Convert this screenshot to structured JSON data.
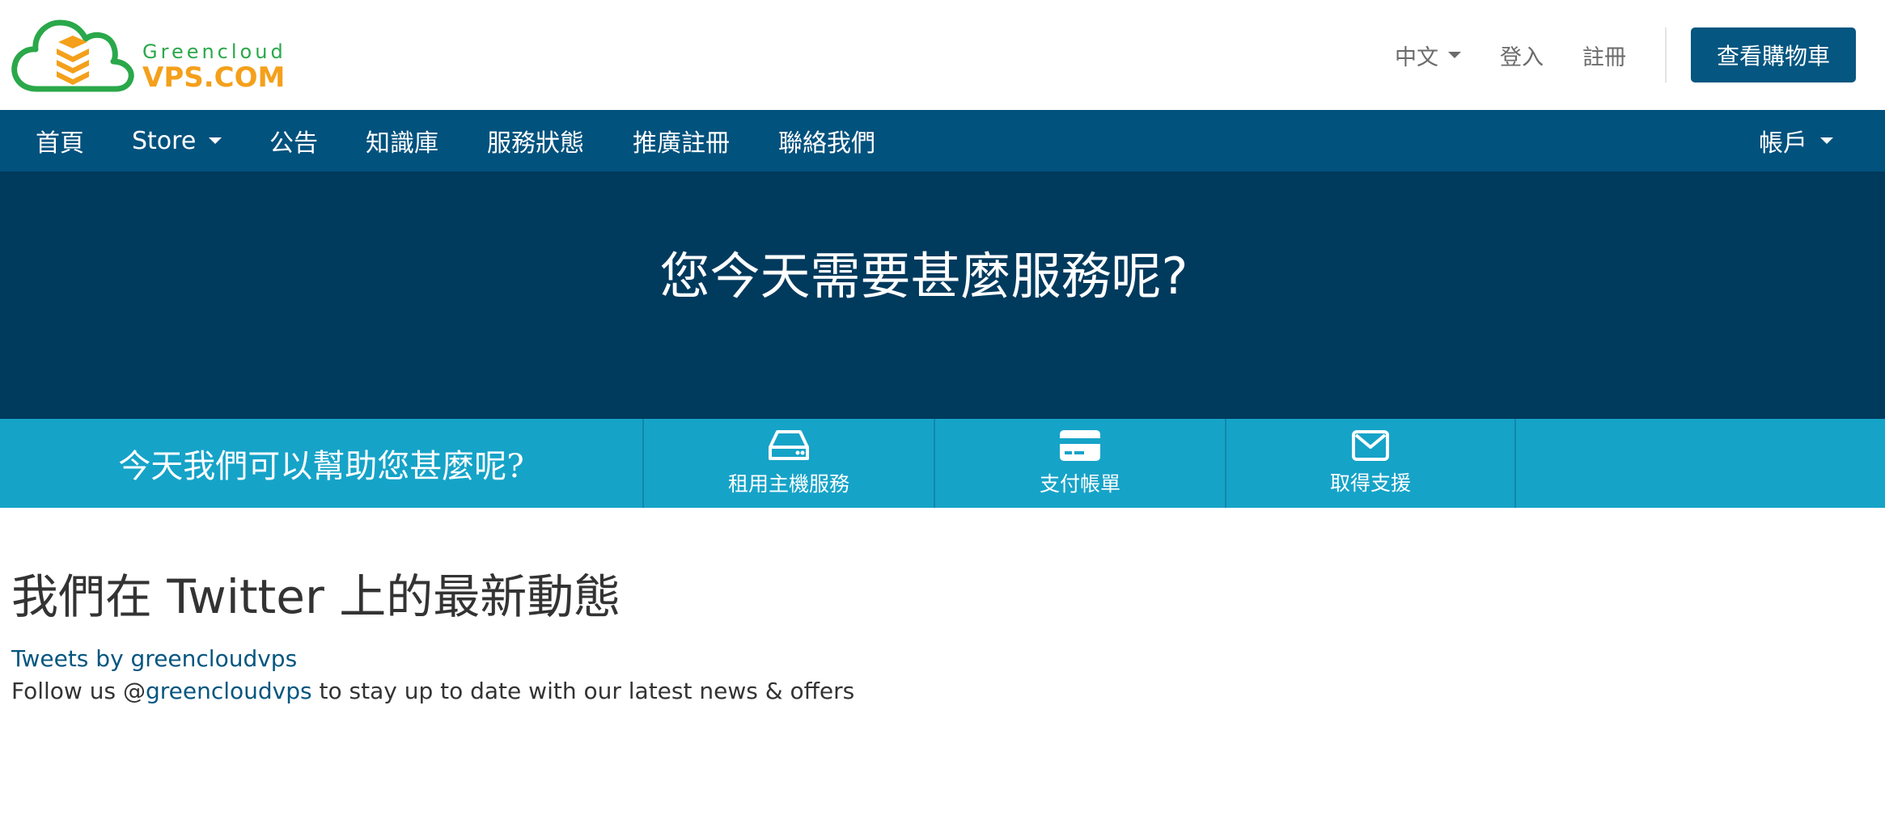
{
  "colors": {
    "brand_green": "#2aa84a",
    "brand_orange": "#f4a01b",
    "nav_bg": "#02527e",
    "hero_bg": "#003a5d",
    "helpbar_bg": "#16a3c8",
    "link": "#055680"
  },
  "logo": {
    "line1": "Greencloud",
    "line2": "VPS.COM"
  },
  "header": {
    "language": "中文",
    "login": "登入",
    "register": "註冊",
    "cart_button": "查看購物車"
  },
  "nav": {
    "items": [
      {
        "label": "首頁"
      },
      {
        "label": "Store"
      },
      {
        "label": "公告"
      },
      {
        "label": "知識庫"
      },
      {
        "label": "服務狀態"
      },
      {
        "label": "推廣註冊"
      },
      {
        "label": "聯絡我們"
      }
    ],
    "account": "帳戶"
  },
  "hero": {
    "title": "您今天需要甚麼服務呢?"
  },
  "help": {
    "prompt": "今天我們可以幫助您甚麼呢?",
    "actions": [
      {
        "label": "租用主機服務",
        "icon": "server-icon"
      },
      {
        "label": "支付帳單",
        "icon": "credit-card-icon"
      },
      {
        "label": "取得支援",
        "icon": "envelope-icon"
      }
    ]
  },
  "twitter": {
    "title": "我們在 Twitter 上的最新動態",
    "tweets_link": "Tweets by greencloudvps",
    "follow_prefix": "Follow us @",
    "follow_handle": "greencloudvps",
    "follow_suffix": " to stay up to date with our latest news & offers"
  }
}
